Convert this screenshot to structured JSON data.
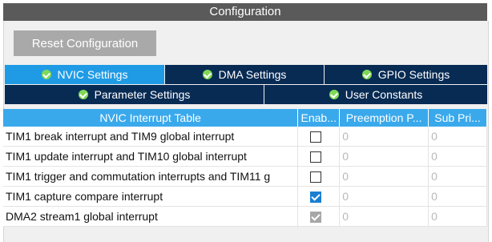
{
  "panel": {
    "title": "Configuration"
  },
  "reset_button": {
    "label": "Reset Configuration"
  },
  "tabs_row1": [
    {
      "label": "NVIC Settings",
      "icon": "check-circle-icon"
    },
    {
      "label": "DMA Settings",
      "icon": "check-circle-icon"
    },
    {
      "label": "GPIO Settings",
      "icon": "check-circle-icon"
    }
  ],
  "tabs_row2": [
    {
      "label": "Parameter Settings",
      "icon": "check-circle-icon"
    },
    {
      "label": "User Constants",
      "icon": "check-circle-icon"
    }
  ],
  "table": {
    "headers": [
      "NVIC Interrupt Table",
      "Enab...",
      "Preemption P...",
      "Sub Pri..."
    ],
    "rows": [
      {
        "name": "TIM1 break interrupt and TIM9 global interrupt",
        "enabled": "unchecked",
        "preemption": "0",
        "sub": "0"
      },
      {
        "name": "TIM1 update interrupt and TIM10 global interrupt",
        "enabled": "unchecked",
        "preemption": "0",
        "sub": "0"
      },
      {
        "name": "TIM1 trigger and commutation interrupts and TIM11 g",
        "enabled": "unchecked",
        "preemption": "0",
        "sub": "0"
      },
      {
        "name": "TIM1 capture compare interrupt",
        "enabled": "checked",
        "preemption": "0",
        "sub": "0"
      },
      {
        "name": "DMA2 stream1 global interrupt",
        "enabled": "checked-disabled",
        "preemption": "0",
        "sub": "0"
      }
    ]
  },
  "colors": {
    "header_bg": "#5a5a5a",
    "tab_active": "#1f9be6",
    "tab_inactive": "#082b54",
    "table_header": "#3aa9ec",
    "check_icon": "#7ed957"
  }
}
